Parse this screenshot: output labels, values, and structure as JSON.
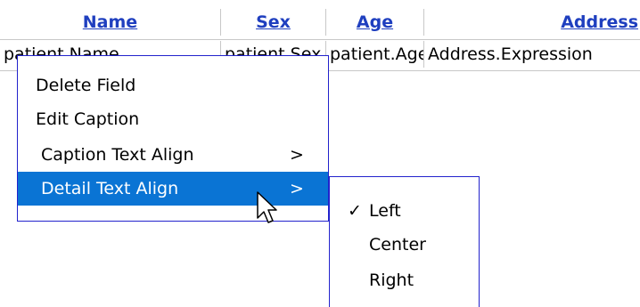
{
  "table": {
    "headers": [
      "Name",
      "Sex",
      "Age",
      "Address"
    ],
    "row": [
      "patient.Name",
      "patient.Sex",
      "patient.Age",
      "Address.Expression"
    ]
  },
  "context_menu": {
    "items": [
      {
        "label": "Delete Field",
        "arrow": ""
      },
      {
        "label": "Edit Caption",
        "arrow": ""
      },
      {
        "label": "Caption Text Align",
        "arrow": ">"
      },
      {
        "label": "Detail Text Align",
        "arrow": ">"
      }
    ],
    "highlight_color": "#0a74d4"
  },
  "submenu": {
    "items": [
      {
        "label": "Left",
        "check": "✓"
      },
      {
        "label": "Center",
        "check": ""
      },
      {
        "label": "Right",
        "check": ""
      }
    ]
  },
  "cursor": "arrow-pointer-icon"
}
